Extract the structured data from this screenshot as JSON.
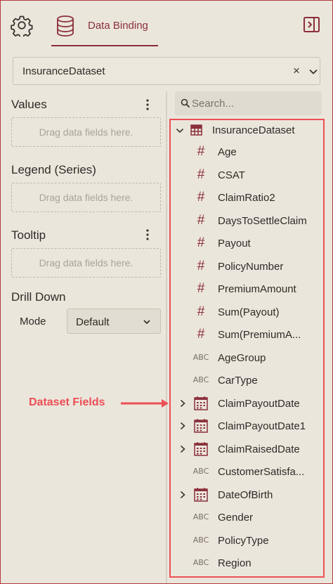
{
  "header": {
    "data_binding_tab": "Data Binding"
  },
  "dataset_select": {
    "value": "InsuranceDataset",
    "clear": "×"
  },
  "sections": {
    "values": {
      "title": "Values",
      "placeholder": "Drag data fields here."
    },
    "legend": {
      "title": "Legend (Series)",
      "placeholder": "Drag data fields here."
    },
    "tooltip": {
      "title": "Tooltip",
      "placeholder": "Drag data fields here."
    },
    "drill_down": {
      "title": "Drill Down",
      "mode_label": "Mode",
      "mode_value": "Default"
    }
  },
  "search": {
    "placeholder": "Search..."
  },
  "tree": {
    "root": "InsuranceDataset",
    "fields": [
      {
        "name": "Age",
        "type": "#",
        "kind": "number",
        "expandable": false
      },
      {
        "name": "CSAT",
        "type": "#",
        "kind": "number",
        "expandable": false
      },
      {
        "name": "ClaimRatio2",
        "type": "#",
        "kind": "number",
        "expandable": false
      },
      {
        "name": "DaysToSettleClaim",
        "type": "#",
        "kind": "number",
        "expandable": false
      },
      {
        "name": "Payout",
        "type": "#",
        "kind": "number",
        "expandable": false
      },
      {
        "name": "PolicyNumber",
        "type": "#",
        "kind": "number",
        "expandable": false
      },
      {
        "name": "PremiumAmount",
        "type": "#",
        "kind": "number",
        "expandable": false
      },
      {
        "name": "Sum(Payout)",
        "type": "#",
        "kind": "number",
        "expandable": false
      },
      {
        "name": "Sum(PremiumA...",
        "type": "#",
        "kind": "number",
        "expandable": false
      },
      {
        "name": "AgeGroup",
        "type": "ABC",
        "kind": "text",
        "expandable": false
      },
      {
        "name": "CarType",
        "type": "ABC",
        "kind": "text",
        "expandable": false
      },
      {
        "name": "ClaimPayoutDate",
        "type": "calendar-icon",
        "kind": "date",
        "expandable": true
      },
      {
        "name": "ClaimPayoutDate1",
        "type": "calendar-icon",
        "kind": "date",
        "expandable": true
      },
      {
        "name": "ClaimRaisedDate",
        "type": "calendar-icon",
        "kind": "date",
        "expandable": true
      },
      {
        "name": "CustomerSatisfa...",
        "type": "ABC",
        "kind": "text",
        "expandable": false
      },
      {
        "name": "DateOfBirth",
        "type": "calendar-icon",
        "kind": "date",
        "expandable": true
      },
      {
        "name": "Gender",
        "type": "ABC",
        "kind": "text",
        "expandable": false
      },
      {
        "name": "PolicyType",
        "type": "ABC",
        "kind": "text",
        "expandable": false
      },
      {
        "name": "Region",
        "type": "ABC",
        "kind": "text",
        "expandable": false
      }
    ]
  },
  "annotation": {
    "label": "Dataset Fields"
  },
  "colors": {
    "accent": "#8a2f3a",
    "annotation": "#ec4f55",
    "background": "#ebe6dc"
  }
}
